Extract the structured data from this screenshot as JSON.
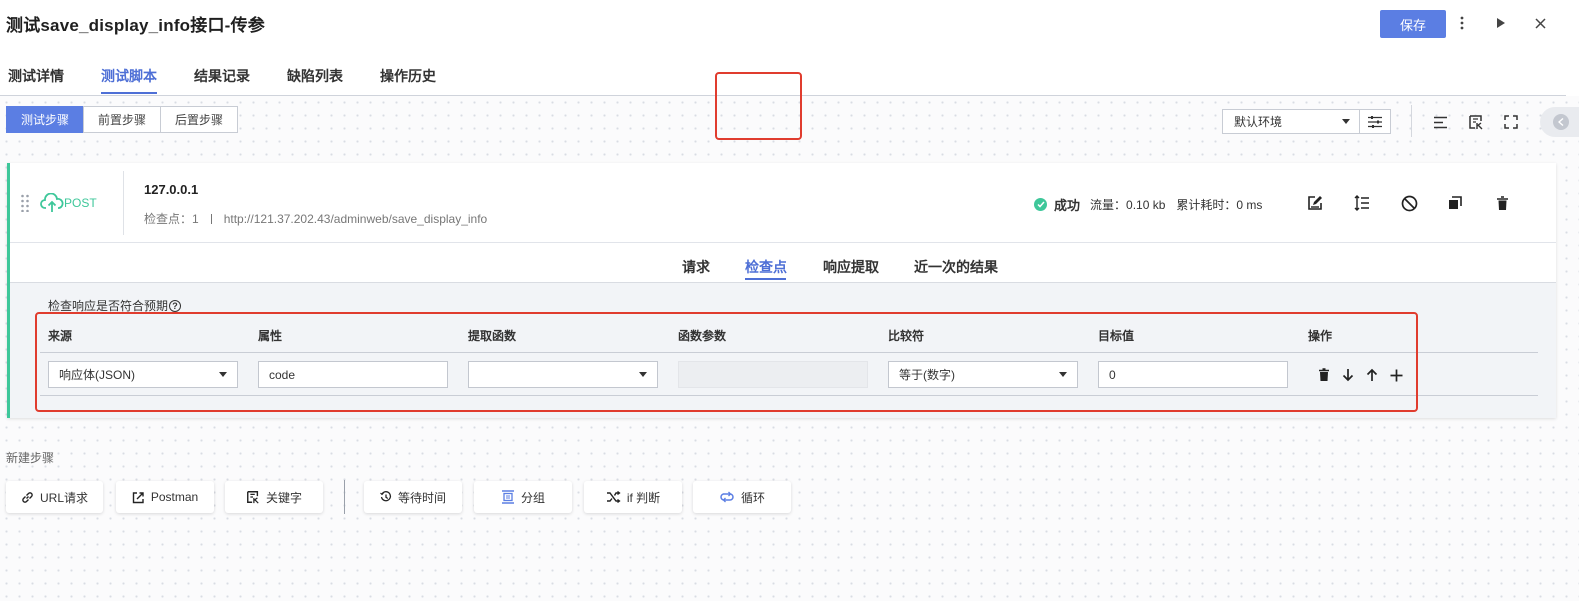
{
  "header": {
    "title": "测试save_display_info接口-传参",
    "save_label": "保存"
  },
  "main_tabs": [
    {
      "label": "测试详情"
    },
    {
      "label": "测试脚本",
      "active": true
    },
    {
      "label": "结果记录"
    },
    {
      "label": "缺陷列表"
    },
    {
      "label": "操作历史"
    }
  ],
  "step_segments": [
    {
      "label": "测试步骤",
      "active": true
    },
    {
      "label": "前置步骤"
    },
    {
      "label": "后置步骤"
    }
  ],
  "environment": {
    "selected": "默认环境"
  },
  "step": {
    "method": "POST",
    "host": "127.0.0.1",
    "checkpoint_label": "检查点：",
    "checkpoint_count": "1",
    "url": "http://121.37.202.43/adminweb/save_display_info",
    "status": "成功",
    "traffic_label": "流量：",
    "traffic_value": "0.10 kb",
    "elapsed_label": "累计耗时：",
    "elapsed_value": "0 ms"
  },
  "sub_tabs": [
    {
      "label": "请求"
    },
    {
      "label": "检查点",
      "active": true
    },
    {
      "label": "响应提取"
    },
    {
      "label": "近一次的结果"
    }
  ],
  "checkpoint": {
    "section_label": "检查响应是否符合预期",
    "help_glyph": "?",
    "columns": [
      "来源",
      "属性",
      "提取函数",
      "函数参数",
      "比较符",
      "目标值",
      "操作"
    ],
    "row": {
      "source": "响应体(JSON)",
      "property": "code",
      "extract_fn": "",
      "fn_param": "",
      "comparator": "等于(数字)",
      "target": "0"
    }
  },
  "new_step": {
    "label": "新建步骤",
    "buttons": [
      {
        "label": "URL请求",
        "icon": "link-icon"
      },
      {
        "label": "Postman",
        "icon": "import-icon"
      },
      {
        "label": "关键字",
        "icon": "keyword-icon"
      },
      {
        "label": "等待时间",
        "icon": "timer-icon"
      },
      {
        "label": "分组",
        "icon": "group-icon"
      },
      {
        "label": "if 判断",
        "icon": "shuffle-icon"
      },
      {
        "label": "循环",
        "icon": "loop-icon"
      }
    ]
  },
  "colors": {
    "primary": "#5b7ee3",
    "success": "#3ec79a",
    "highlight": "#e03c2e"
  }
}
